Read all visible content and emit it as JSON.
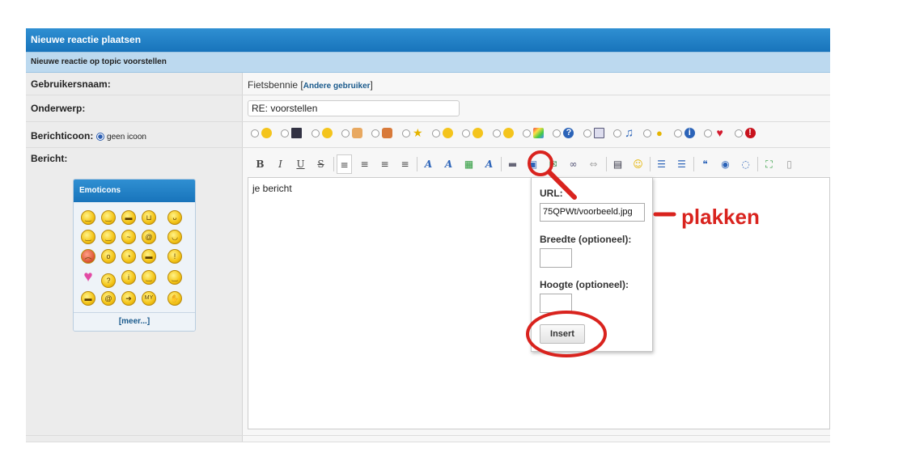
{
  "form": {
    "title": "Nieuwe reactie plaatsen",
    "subtitle": "Nieuwe reactie op topic voorstellen",
    "username_label": "Gebruikersnaam:",
    "username_value": "Fietsbennie",
    "other_user_open": "[",
    "other_user_link": "Andere gebruiker",
    "other_user_close": "]",
    "subject_label": "Onderwerp:",
    "subject_value": "RE: voorstellen",
    "icon_label": "Berichticoon:",
    "no_icon_label": "geen icoon",
    "message_label": "Bericht:"
  },
  "post_icons": [
    "smile-icon",
    "film-icon",
    "tongue-icon",
    "thumbs-up-icon",
    "thumbs-down-icon",
    "star-icon",
    "angry-icon",
    "shocked-icon",
    "sad-icon",
    "rainbow-icon",
    "question-icon",
    "screen-icon",
    "music-icon",
    "lightbulb-icon",
    "info-icon",
    "heart-icon",
    "exclamation-icon"
  ],
  "toolbar": {
    "bold": "B",
    "italic": "I",
    "underline": "U",
    "strike": "S"
  },
  "editor": {
    "content": "je bericht"
  },
  "emoticons": {
    "title": "Emoticons",
    "more": "[meer...]",
    "icons": [
      "smile",
      "grin",
      "cool",
      "laugh",
      "tongue",
      "blush",
      "wink",
      "confused",
      "at",
      "ears",
      "mad",
      "pout",
      "roll",
      "shades",
      "alert",
      "heart",
      "question",
      "idea",
      "sigh",
      "wry",
      "ninja",
      "dizzy",
      "arrow",
      "my",
      "wave"
    ]
  },
  "popup": {
    "url_label": "URL:",
    "url_value": "75QPWt/voorbeeld.jpg",
    "width_label": "Breedte (optioneel):",
    "height_label": "Hoogte (optioneel):",
    "insert_label": "Insert"
  },
  "annotation": {
    "text": "plakken",
    "color": "#d9231e"
  }
}
